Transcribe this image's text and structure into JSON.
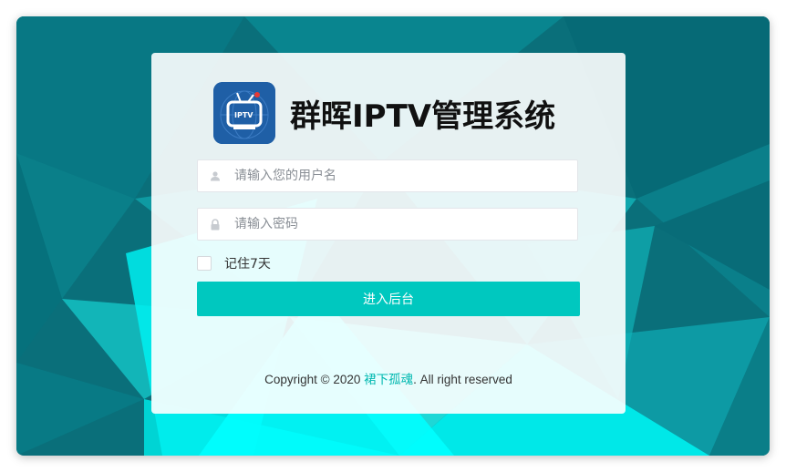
{
  "app": {
    "title": "群晖IPTV管理系统",
    "logo_icon": "iptv-tv-logo",
    "logo_text": "IPTV"
  },
  "form": {
    "username_placeholder": "请输入您的用户名",
    "username_value": "",
    "password_placeholder": "请输入密码",
    "password_value": "",
    "remember_label": "记住7天",
    "remember_checked": false,
    "submit_label": "进入后台"
  },
  "footer": {
    "prefix": "Copyright © 2020 ",
    "author_link": "裙下孤魂",
    "suffix": ". All right reserved"
  },
  "colors": {
    "accent": "#00c8bf",
    "link": "#00b8b0",
    "logo_bg": "#1f5fa6",
    "background_dark": "#0a6f7a",
    "background_light": "#00f5f5"
  },
  "icons": {
    "username": "user-icon",
    "password": "lock-icon"
  }
}
